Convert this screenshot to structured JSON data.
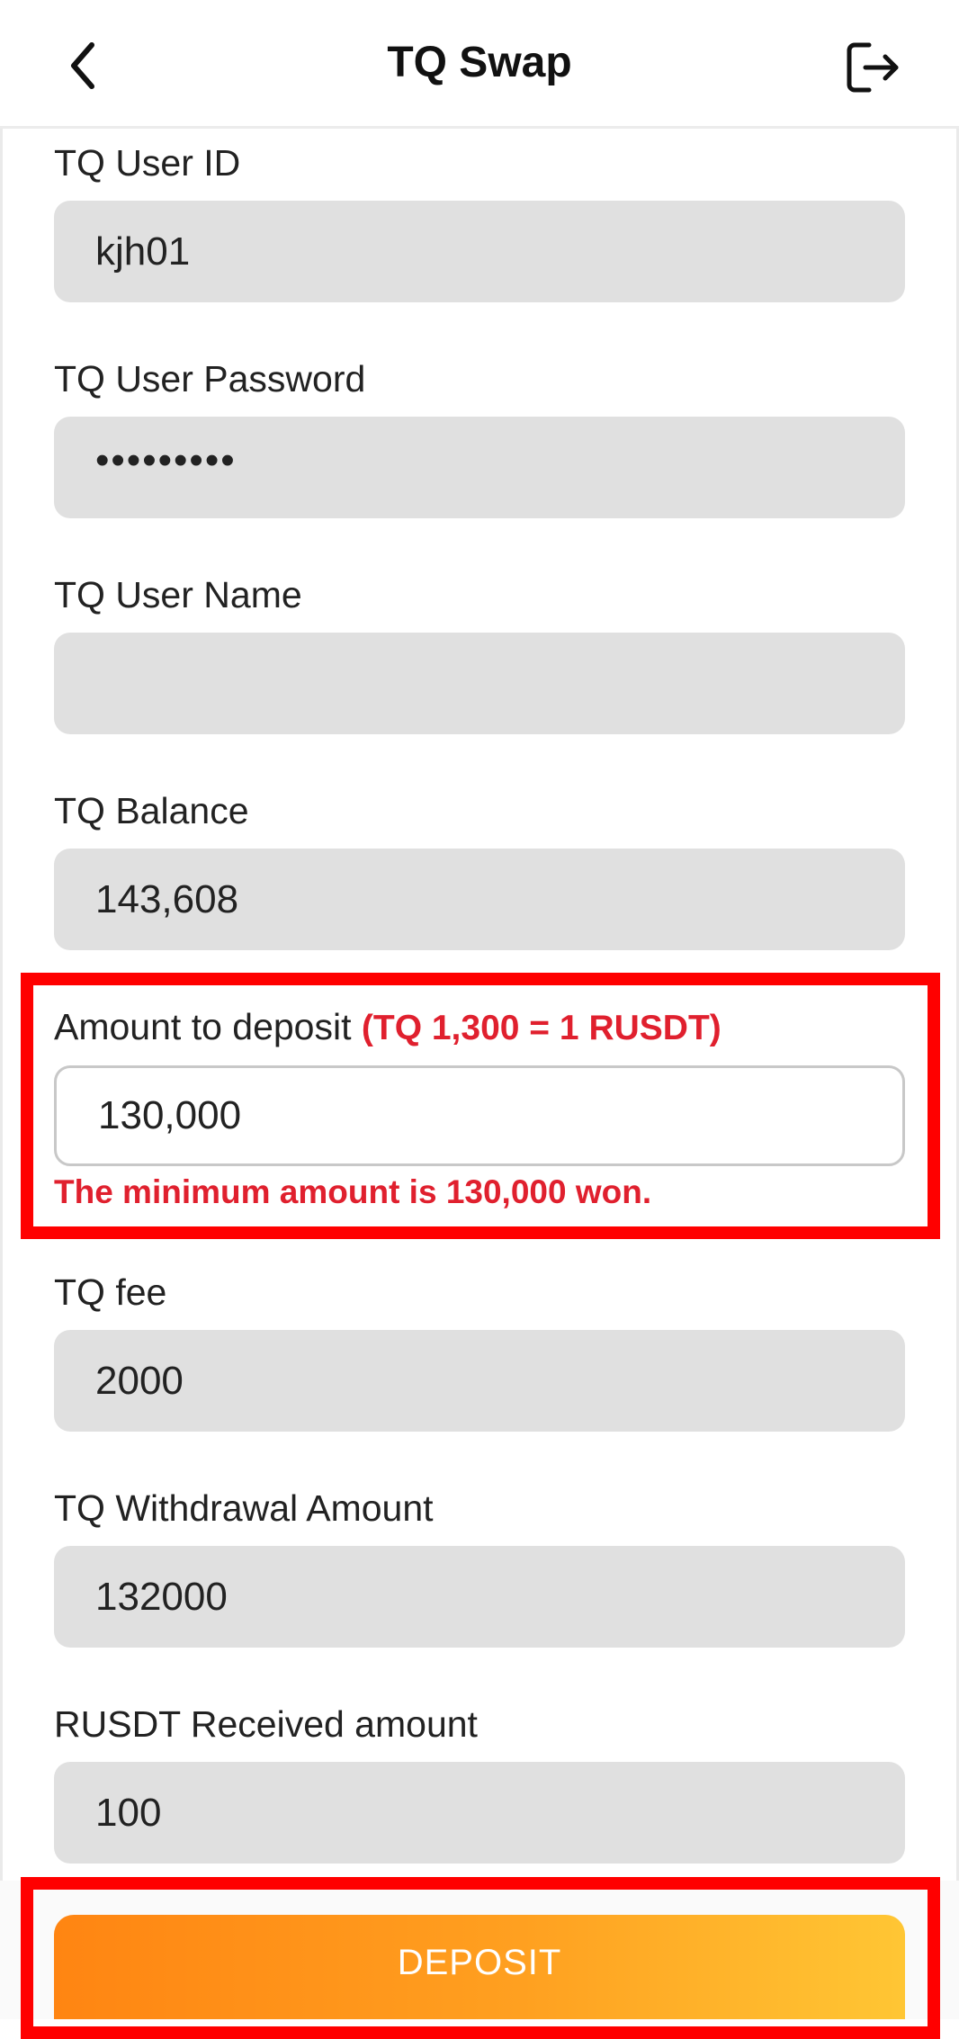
{
  "header": {
    "title": "TQ Swap",
    "back_icon": "chevron-left-icon",
    "logout_icon": "logout-icon"
  },
  "form": {
    "user_id": {
      "label": "TQ User ID",
      "value": "kjh01"
    },
    "password": {
      "label": "TQ User Password",
      "value": "•••••••••"
    },
    "user_name": {
      "label": "TQ User Name",
      "value": ""
    },
    "balance": {
      "label": "TQ Balance",
      "value": "143,608"
    },
    "deposit": {
      "label": "Amount to deposit",
      "rate": "(TQ 1,300 = 1 RUSDT)",
      "value": "130,000",
      "error": "The minimum amount is 130,000 won."
    },
    "fee": {
      "label": "TQ fee",
      "value": "2000"
    },
    "withdrawal": {
      "label": "TQ Withdrawal Amount",
      "value": "132000"
    },
    "received": {
      "label": "RUSDT Received amount",
      "value": "100"
    }
  },
  "actions": {
    "deposit_label": "DEPOSIT"
  },
  "colors": {
    "accent_error": "#e0202e",
    "highlight": "#ff0000",
    "button_start": "#ff8512",
    "button_end": "#ffc634"
  }
}
